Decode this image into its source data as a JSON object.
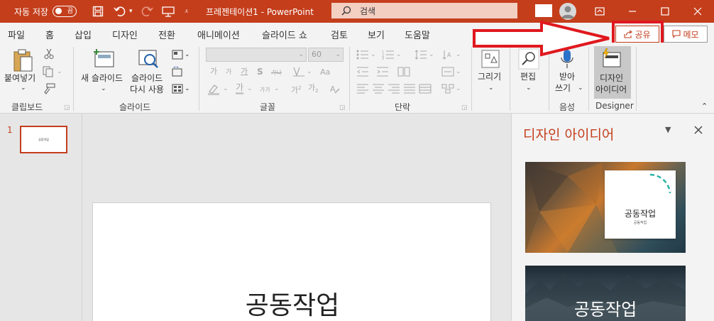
{
  "titlebar": {
    "autosave_label": "자동 저장",
    "autosave_state": "끔",
    "doc_title": "프레젠테이션1  -  PowerPoint",
    "search_placeholder": "검색",
    "accent": "#c43e1c"
  },
  "tabs": [
    "파일",
    "홈",
    "삽입",
    "디자인",
    "전환",
    "애니메이션",
    "슬라이드 쇼",
    "검토",
    "보기",
    "도움말"
  ],
  "active_tab": "홈",
  "share_label": "공유",
  "memo_label": "메모",
  "ribbon": {
    "clipboard": {
      "paste": "붙여넣기",
      "group": "클립보드"
    },
    "slides": {
      "new_slide": "새 슬라이드",
      "reuse_1": "슬라이드",
      "reuse_2": "다시 사용",
      "group": "슬라이드"
    },
    "font": {
      "size": "60",
      "group": "글꼴",
      "grow": "가",
      "shrink": "가",
      "clear": "가",
      "strike": "S",
      "spacing": "가나",
      "underline": "가",
      "case": "가가",
      "sup": "가",
      "sub": "가"
    },
    "paragraph": {
      "group": "단락"
    },
    "drawing": {
      "label": "그리기"
    },
    "editing": {
      "label": "편집"
    },
    "voice": {
      "label_1": "받아",
      "label_2": "쓰기",
      "group": "음성"
    },
    "designer": {
      "label_1": "디자인",
      "label_2": "아이디어",
      "group": "Designer"
    }
  },
  "slides_panel": {
    "slide_number": "1",
    "thumb_text": "공동작업"
  },
  "slide": {
    "title": "공동작업"
  },
  "designer_pane": {
    "title": "디자인 아이디어",
    "idea1_title": "공동작업",
    "idea1_sub": "공동작업",
    "idea2_title": "공동작업"
  }
}
